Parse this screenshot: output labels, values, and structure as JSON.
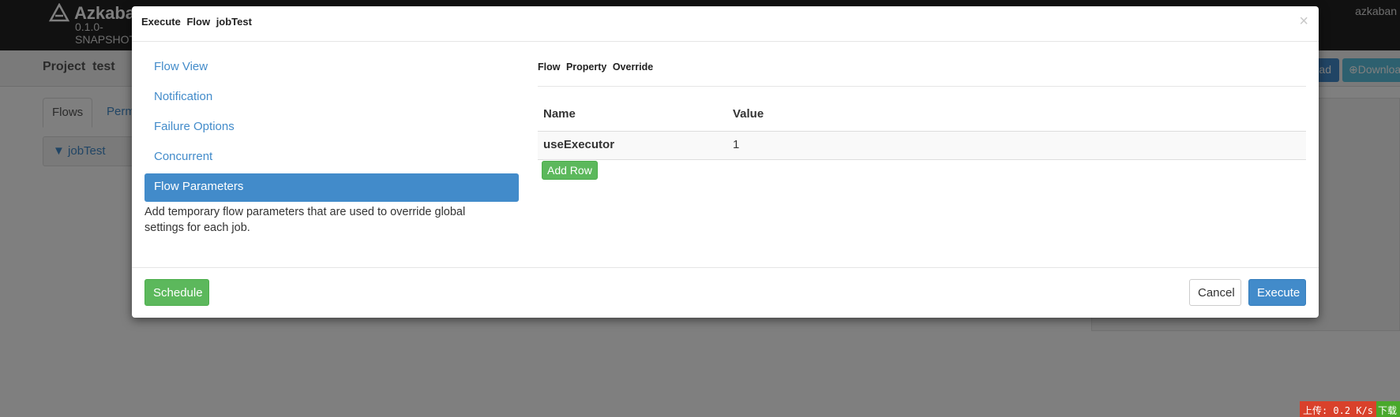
{
  "app": {
    "brand_name": "Azkaban",
    "version_line1": "0.1.0-",
    "version_line2": "SNAPSHOT",
    "user": "azkaban"
  },
  "project": {
    "title": "Project  test",
    "upload_label": "Upload",
    "download_label": "Download"
  },
  "page_tabs": [
    "Flows",
    "Permissions"
  ],
  "flow_row": {
    "label": "jobTest"
  },
  "modal": {
    "title": "Execute Flow jobTest",
    "close_glyph": "×",
    "nav_items": [
      "Flow View",
      "Notification",
      "Failure Options",
      "Concurrent",
      "Flow Parameters"
    ],
    "active_nav": "Flow Parameters",
    "help_text": "Add temporary flow parameters that are used to override global settings for each job.",
    "section_title": "Flow Property Override",
    "table": {
      "columns": [
        "Name",
        "Value"
      ],
      "rows": [
        {
          "name": "useExecutor",
          "value": "1"
        }
      ]
    },
    "add_row_label": "Add Row",
    "footer": {
      "schedule_label": "Schedule",
      "cancel_label": "Cancel",
      "execute_label": "Execute"
    }
  },
  "speed_widget": {
    "upload_text": "上传: 0.2 K/s",
    "download_text": "下载"
  },
  "colors": {
    "primary": "#428bca",
    "success": "#5cb85c",
    "info": "#5bc0de",
    "navbar": "#222222"
  }
}
